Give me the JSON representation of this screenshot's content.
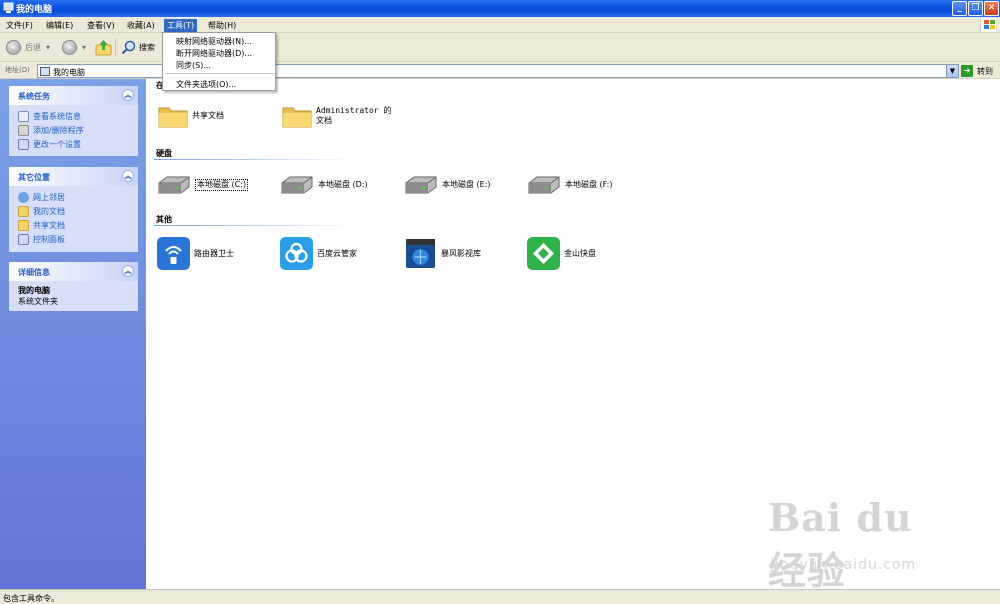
{
  "window": {
    "title": "我的电脑",
    "minimize_icon": "minimize-icon",
    "maximize_icon": "restore-icon",
    "close_icon": "close-icon"
  },
  "menubar": {
    "items": [
      {
        "label": "文件(F)"
      },
      {
        "label": "编辑(E)"
      },
      {
        "label": "查看(V)"
      },
      {
        "label": "收藏(A)"
      },
      {
        "label": "工具(T)"
      },
      {
        "label": "帮助(H)"
      }
    ],
    "active": "工具(T)"
  },
  "toolbar": {
    "back_label": "后退",
    "search_label": "搜索"
  },
  "tools_menu": {
    "items": [
      {
        "label": "映射网络驱动器(N)..."
      },
      {
        "label": "断开网络驱动器(D)..."
      },
      {
        "label": "同步(S)..."
      },
      {
        "label": "文件夹选项(O)..."
      }
    ]
  },
  "address": {
    "label": "地址(D)",
    "value": "我的电脑",
    "go_label": "转到"
  },
  "left_pane": {
    "system_tasks": {
      "title": "系统任务",
      "items": [
        {
          "label": "查看系统信息"
        },
        {
          "label": "添加/删除程序"
        },
        {
          "label": "更改一个设置"
        }
      ]
    },
    "other_places": {
      "title": "其它位置",
      "items": [
        {
          "label": "网上邻居"
        },
        {
          "label": "我的文档"
        },
        {
          "label": "共享文档"
        },
        {
          "label": "控制面板"
        }
      ]
    },
    "details": {
      "title": "详细信息",
      "name": "我的电脑",
      "type": "系统文件夹"
    }
  },
  "content": {
    "group_stored_label": "在",
    "folders": [
      {
        "label": "共享文档"
      },
      {
        "label": "Administrator 的文档"
      }
    ],
    "group_drives": "硬盘",
    "drives": [
      {
        "label": "本地磁盘 (C:)"
      },
      {
        "label": "本地磁盘 (D:)"
      },
      {
        "label": "本地磁盘 (E:)"
      },
      {
        "label": "本地磁盘 (F:)"
      }
    ],
    "group_other": "其他",
    "others": [
      {
        "label": "路由器卫士"
      },
      {
        "label": "百度云管家"
      },
      {
        "label": "暴风影视库"
      },
      {
        "label": "金山快盘"
      }
    ]
  },
  "statusbar": {
    "text": "包含工具命令。"
  },
  "watermark": {
    "logo": "Bai du 经验",
    "url": "jingyan.baidu.com"
  },
  "colors": {
    "titlebar": "#0b53e0",
    "task_pane": "#6e8be0",
    "task_link": "#215dc6",
    "menu_highlight": "#316ac5"
  }
}
